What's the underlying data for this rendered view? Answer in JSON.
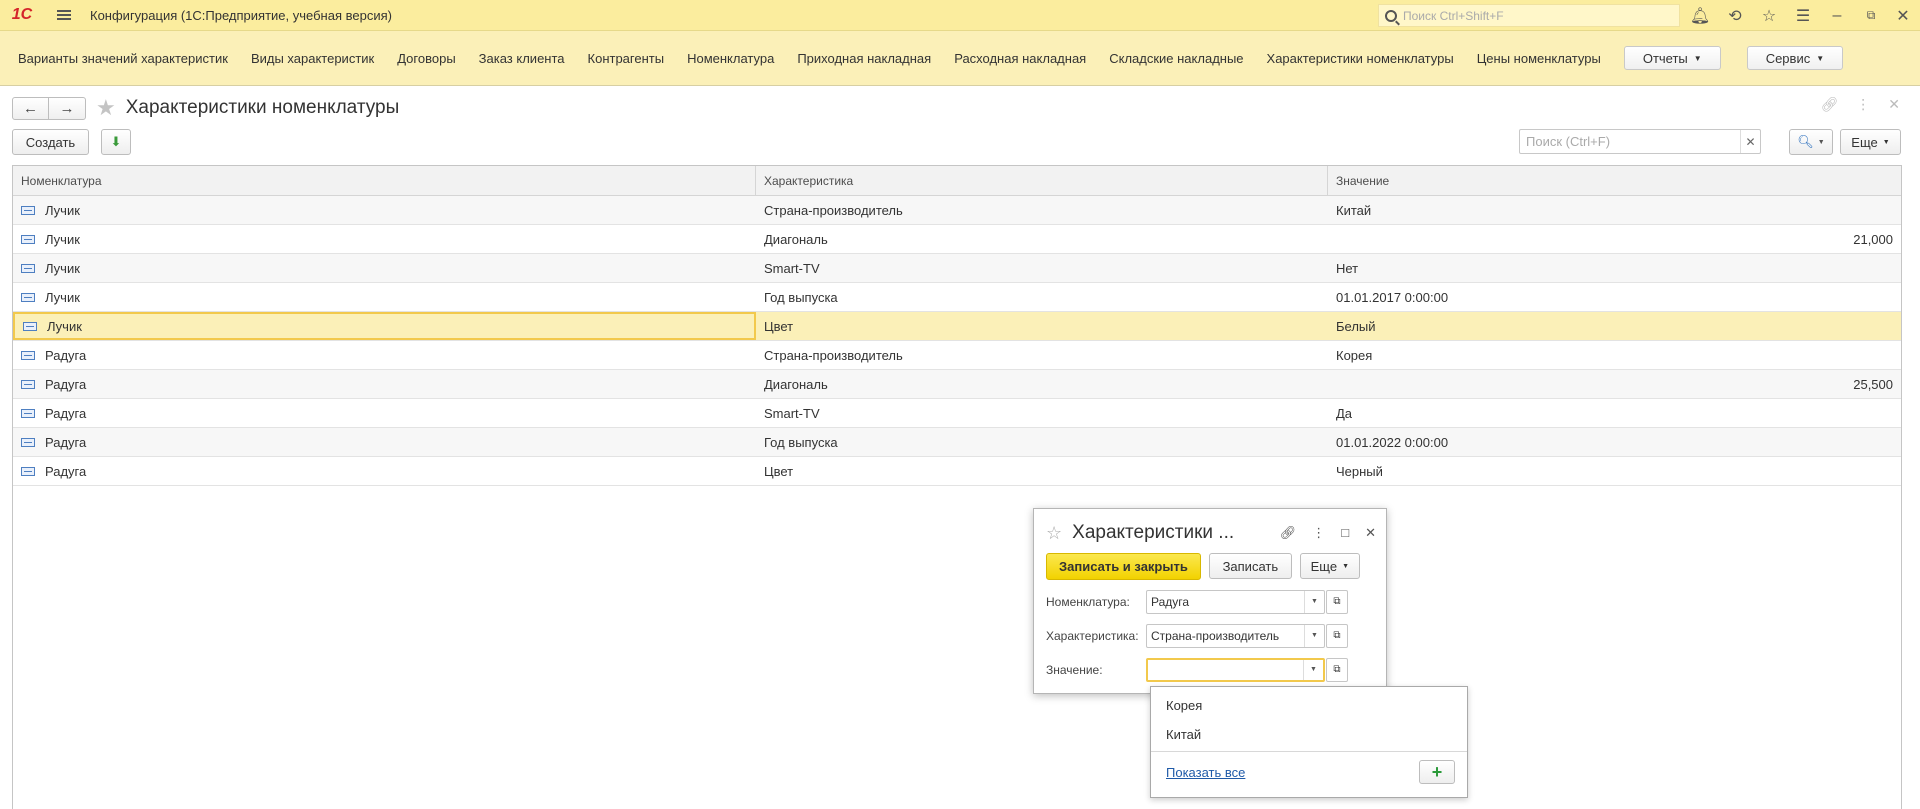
{
  "titlebar": {
    "logo": "1С",
    "app_title": "Конфигурация  (1С:Предприятие, учебная версия)",
    "search_placeholder": "Поиск Ctrl+Shift+F"
  },
  "sections": {
    "items": [
      "Варианты значений характеристик",
      "Виды характеристик",
      "Договоры",
      "Заказ клиента",
      "Контрагенты",
      "Номенклатура",
      "Приходная накладная",
      "Расходная накладная",
      "Складские накладные",
      "Характеристики номенклатуры",
      "Цены номенклатуры"
    ],
    "reports_label": "Отчеты",
    "service_label": "Сервис"
  },
  "form": {
    "title": "Характеристики номенклатуры",
    "create_label": "Создать",
    "search_placeholder": "Поиск (Ctrl+F)",
    "more_label": "Еще"
  },
  "table": {
    "columns": [
      "Номенклатура",
      "Характеристика",
      "Значение"
    ],
    "rows": [
      {
        "item": "Лучик",
        "characteristic": "Страна-производитель",
        "value": "Китай",
        "numeric": false
      },
      {
        "item": "Лучик",
        "characteristic": "Диагональ",
        "value": "21,000",
        "numeric": true
      },
      {
        "item": "Лучик",
        "characteristic": "Smart-TV",
        "value": "Нет",
        "numeric": false
      },
      {
        "item": "Лучик",
        "characteristic": "Год выпуска",
        "value": "01.01.2017 0:00:00",
        "numeric": false
      },
      {
        "item": "Лучик",
        "characteristic": "Цвет",
        "value": "Белый",
        "numeric": false,
        "selected": true
      },
      {
        "item": "Радуга",
        "characteristic": "Страна-производитель",
        "value": "Корея",
        "numeric": false
      },
      {
        "item": "Радуга",
        "characteristic": "Диагональ",
        "value": "25,500",
        "numeric": true
      },
      {
        "item": "Радуга",
        "characteristic": "Smart-TV",
        "value": "Да",
        "numeric": false
      },
      {
        "item": "Радуга",
        "characteristic": "Год выпуска",
        "value": "01.01.2022 0:00:00",
        "numeric": false
      },
      {
        "item": "Радуга",
        "characteristic": "Цвет",
        "value": "Черный",
        "numeric": false
      }
    ]
  },
  "dialog": {
    "title": "Характеристики ...",
    "save_close_label": "Записать и закрыть",
    "save_label": "Записать",
    "more_label": "Еще",
    "fields": {
      "nomenclature_label": "Номенклатура:",
      "nomenclature_value": "Радуга",
      "characteristic_label": "Характеристика:",
      "characteristic_value": "Страна-производитель",
      "value_label": "Значение:",
      "value_value": ""
    }
  },
  "dropdown": {
    "options": [
      "Корея",
      "Китай"
    ],
    "show_all_label": "Показать все",
    "add_label": "+"
  },
  "colors": {
    "titlebar_bg": "#fbed9e",
    "sections_bg": "#fbf0b8",
    "selected_row": "#fbf0b8",
    "primary_button": "#f2d200",
    "link": "#1f5aa8"
  }
}
